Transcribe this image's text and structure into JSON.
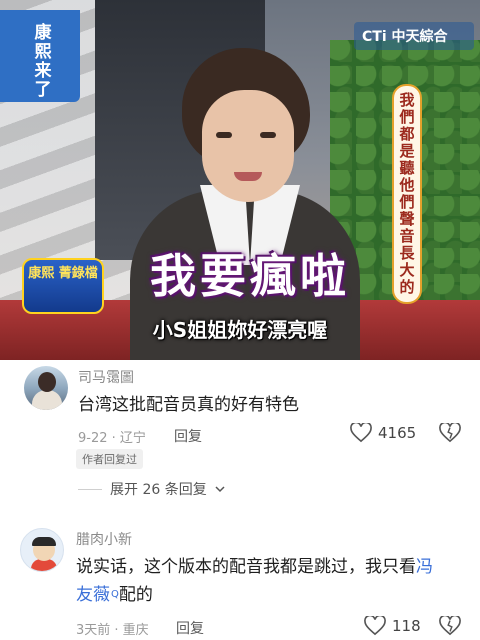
{
  "video": {
    "show_pillar": "康熙来了",
    "channel_logo": "CTi 中天綜合",
    "vertical_caption": "我們都是聽他們聲音長大的",
    "badge_text": "康熙 菁錄檔",
    "big_caption": "我要瘋啦",
    "subtitle": "小S姐姐妳好漂亮喔"
  },
  "comments": [
    {
      "username": "司马霭圖",
      "text": "台湾这批配音员真的好有特色",
      "date_location": "9-22 · 辽宁",
      "reply_label": "回复",
      "likes": "4165",
      "tag": "作者回复过",
      "expand_label": "展开 26 条回复"
    },
    {
      "username": "腊肉小新",
      "text_part1": "说实话，这个版本的配音我都是跳过，我只看",
      "link_name_1": "冯",
      "link_name_2": "友薇",
      "text_part2": "配的",
      "date_location": "3天前 · 重庆",
      "reply_label": "回复",
      "likes": "118"
    }
  ],
  "icons": {
    "like": "heart-outline-icon",
    "dislike": "broken-heart-icon",
    "expand": "chevron-down-icon",
    "search_mark": "q-superscript-icon"
  },
  "colors": {
    "link": "#3a6fd8",
    "meta": "#9a9a9a"
  }
}
